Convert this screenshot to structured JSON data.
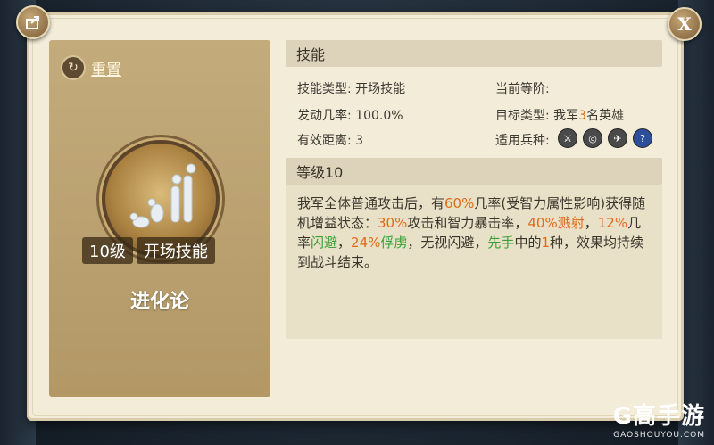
{
  "buttons": {
    "close_label": "X"
  },
  "left": {
    "reset_label": "重置",
    "level": "10级",
    "skill_type_tag": "开场技能",
    "skill_name": "进化论"
  },
  "skill_section": {
    "title": "技能",
    "type_label": "技能类型:",
    "type_value": "开场技能",
    "rate_label": "发动几率:",
    "rate_value": "100.0%",
    "range_label": "有效距离:",
    "range_value": "3",
    "tier_label": "当前等阶:",
    "target_label": "目标类型:",
    "target_pre": "我军",
    "target_num": "3",
    "target_post": "名英雄",
    "troops_label": "适用兵种:",
    "troops": [
      {
        "icon": "sword-icon",
        "glyph": "⚔"
      },
      {
        "icon": "target-icon",
        "glyph": "◎"
      },
      {
        "icon": "plane-icon",
        "glyph": "✈"
      },
      {
        "icon": "question-icon",
        "glyph": "?"
      }
    ]
  },
  "level_section": {
    "title": "等级10",
    "d1": "我军全体普通攻击后，有",
    "d2": "60%",
    "d3": "几率(受智力属性影响)获得随机增益状态：",
    "d4": "30%",
    "d5": "攻击和智力暴击率，",
    "d6": "40%",
    "d7": "溅射",
    "d8": "，",
    "d9": "12%",
    "d10": "几率",
    "d11": "闪避",
    "d12": "，",
    "d13": "24%",
    "d14": "俘虏",
    "d15": "，无视闪避，",
    "d16": "先手",
    "d17": "中的",
    "d18": "1",
    "d19": "种，效果均持续到战斗结束。"
  },
  "watermark": {
    "logo": "G高手游",
    "sub": "GAOSHOUYOU.COM"
  },
  "colors": {
    "accent_orange": "#e06a1a",
    "accent_green": "#3aa036"
  }
}
